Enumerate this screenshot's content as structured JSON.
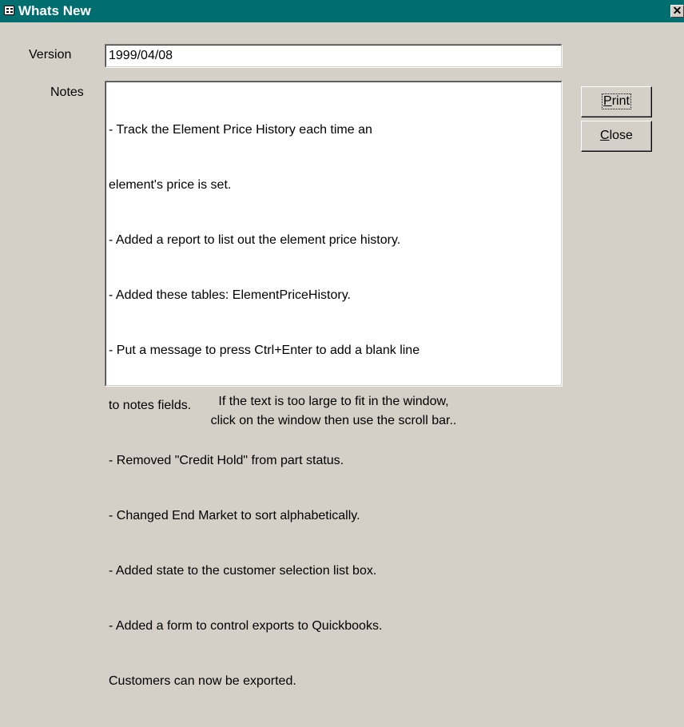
{
  "window": {
    "title": "Whats New",
    "close_glyph": "✕"
  },
  "version": {
    "label": "Version",
    "value": "1999/04/08"
  },
  "notes": {
    "label": "Notes",
    "lines": [
      "- Track the Element Price History each time an",
      "element's price is set.",
      "- Added a report to list out the element price history.",
      "- Added these tables: ElementPriceHistory.",
      "- Put a message to press Ctrl+Enter to add a blank line",
      "to notes fields.",
      "- Removed \"Credit Hold\" from part status.",
      "- Changed End Market to sort alphabetically.",
      "- Added state to the customer selection list box.",
      "- Added a form to control exports to Quickbooks.",
      "Customers can now be exported."
    ]
  },
  "buttons": {
    "print": {
      "mnemonic": "P",
      "rest": "rint"
    },
    "close": {
      "mnemonic": "C",
      "rest": "lose"
    }
  },
  "hint": {
    "line1": "If the text is too large to fit in the window,",
    "line2": "click on the window then use the scroll bar.."
  },
  "colors": {
    "titlebar": "#006e6e",
    "face": "#d4d0c8"
  },
  "icons": {
    "title": "form-icon",
    "close": "close-icon"
  }
}
